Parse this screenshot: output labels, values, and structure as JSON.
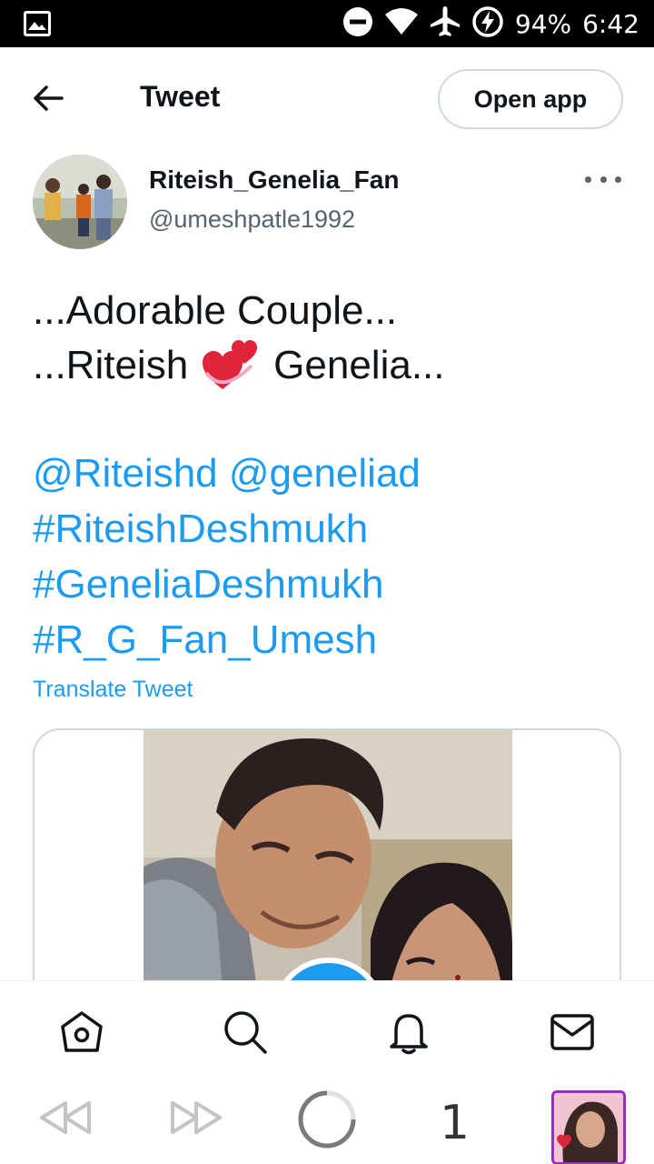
{
  "status_bar": {
    "battery": "94%",
    "time": "6:42",
    "icons": [
      "gallery-icon",
      "do-not-disturb-icon",
      "wifi-icon",
      "airplane-icon",
      "battery-charging-icon"
    ]
  },
  "header": {
    "back_icon": "arrow-left-icon",
    "title": "Tweet",
    "open_app_label": "Open app"
  },
  "author": {
    "name": "Riteish_Genelia_Fan",
    "handle": "@umeshpatle1992",
    "more_icon": "more-horizontal-icon"
  },
  "tweet": {
    "line1": "...Adorable Couple...",
    "line2_before": "...Riteish",
    "line2_emoji": "revolving-hearts-emoji",
    "line2_after": "Genelia...",
    "tag_lines": [
      "@Riteishd @geneliad",
      "#RiteishDeshmukh",
      "#GeneliaDeshmukh",
      "#R_G_Fan_Umesh"
    ],
    "translate_label": "Translate Tweet"
  },
  "bottom_nav": {
    "items": [
      "home-icon",
      "search-icon",
      "notifications-bell-icon",
      "messages-envelope-icon"
    ]
  },
  "media_controls": {
    "rewind_icon": "rewind-icon",
    "forward_icon": "fast-forward-icon",
    "loading_icon": "loading-spinner-icon",
    "count": "1"
  },
  "colors": {
    "accent": "#1d9bf0",
    "text": "#0f1419",
    "muted": "#536471",
    "border": "#cfd9de"
  }
}
